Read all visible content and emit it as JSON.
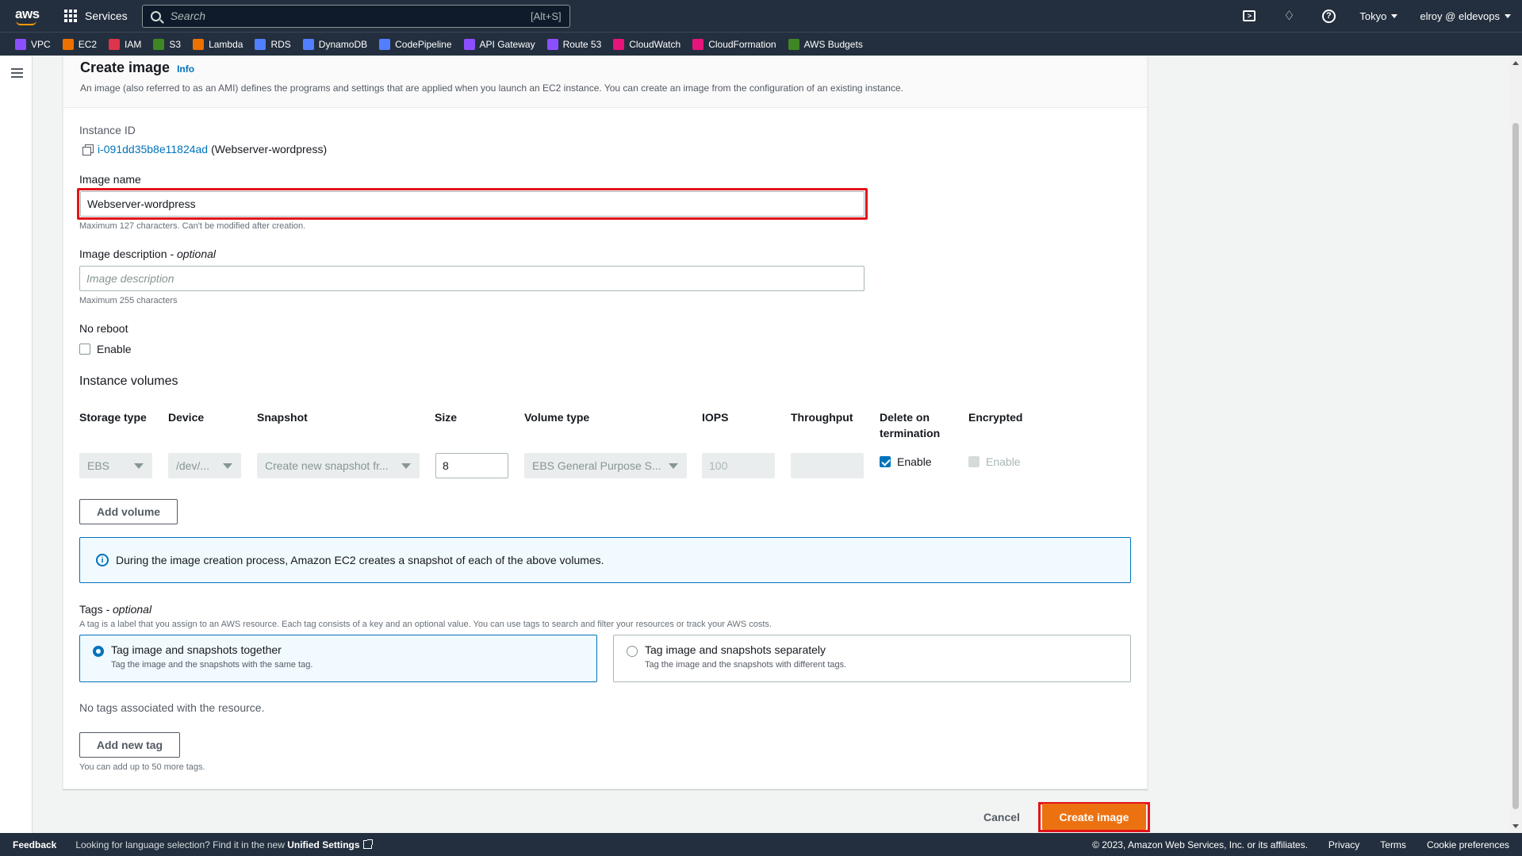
{
  "topnav": {
    "logo": "aws",
    "services_label": "Services",
    "search_placeholder": "Search",
    "search_shortcut": "[Alt+S]",
    "region": "Tokyo",
    "account": "elroy @ eldevops",
    "icons": [
      "cloudshell-icon",
      "bell-icon",
      "help-icon"
    ]
  },
  "favorites": [
    {
      "label": "VPC",
      "color": "#8c4fff"
    },
    {
      "label": "EC2",
      "color": "#ed7100"
    },
    {
      "label": "IAM",
      "color": "#dd344c"
    },
    {
      "label": "S3",
      "color": "#3f8624"
    },
    {
      "label": "Lambda",
      "color": "#ed7100"
    },
    {
      "label": "RDS",
      "color": "#527fff"
    },
    {
      "label": "DynamoDB",
      "color": "#527fff"
    },
    {
      "label": "CodePipeline",
      "color": "#527fff"
    },
    {
      "label": "API Gateway",
      "color": "#8c4fff"
    },
    {
      "label": "Route 53",
      "color": "#8c4fff"
    },
    {
      "label": "CloudWatch",
      "color": "#e7157b"
    },
    {
      "label": "CloudFormation",
      "color": "#e7157b"
    },
    {
      "label": "AWS Budgets",
      "color": "#3f8624"
    }
  ],
  "page": {
    "title": "Create image",
    "info": "Info",
    "description": "An image (also referred to as an AMI) defines the programs and settings that are applied when you launch an EC2 instance. You can create an image from the configuration of an existing instance."
  },
  "instance": {
    "label": "Instance ID",
    "id": "i-091dd35b8e11824ad",
    "name": "(Webserver-wordpress)"
  },
  "image_name": {
    "label": "Image name",
    "value": "Webserver-wordpress",
    "hint": "Maximum 127 characters. Can't be modified after creation."
  },
  "image_description": {
    "label": "Image description",
    "optional": "- optional",
    "placeholder": "Image description",
    "hint": "Maximum 255 characters"
  },
  "no_reboot": {
    "label": "No reboot",
    "checkbox_label": "Enable",
    "checked": false
  },
  "volumes": {
    "title": "Instance volumes",
    "columns": [
      "Storage type",
      "Device",
      "Snapshot",
      "Size",
      "Volume type",
      "IOPS",
      "Throughput",
      "Delete on termination",
      "Encrypted"
    ],
    "row": {
      "storage_type": "EBS",
      "device": "/dev/...",
      "snapshot": "Create new snapshot fr...",
      "size": "8",
      "volume_type": "EBS General Purpose S...",
      "iops": "100",
      "throughput": "",
      "delete_label": "Enable",
      "encrypted_label": "Enable"
    },
    "add_button": "Add volume"
  },
  "alert": {
    "text": "During the image creation process, Amazon EC2 creates a snapshot of each of the above volumes."
  },
  "tags": {
    "label": "Tags",
    "optional": "- optional",
    "description": "A tag is a label that you assign to an AWS resource. Each tag consists of a key and an optional value. You can use tags to search and filter your resources or track your AWS costs.",
    "options": [
      {
        "title": "Tag image and snapshots together",
        "sub": "Tag the image and the snapshots with the same tag.",
        "selected": true
      },
      {
        "title": "Tag image and snapshots separately",
        "sub": "Tag the image and the snapshots with different tags.",
        "selected": false
      }
    ],
    "empty": "No tags associated with the resource.",
    "add_button": "Add new tag",
    "limit_hint": "You can add up to 50 more tags."
  },
  "actions": {
    "cancel": "Cancel",
    "submit": "Create image"
  },
  "footer": {
    "feedback": "Feedback",
    "language_prefix": "Looking for language selection? Find it in the new",
    "language_link": "Unified Settings",
    "copyright": "© 2023, Amazon Web Services, Inc. or its affiliates.",
    "links": [
      "Privacy",
      "Terms",
      "Cookie preferences"
    ]
  }
}
